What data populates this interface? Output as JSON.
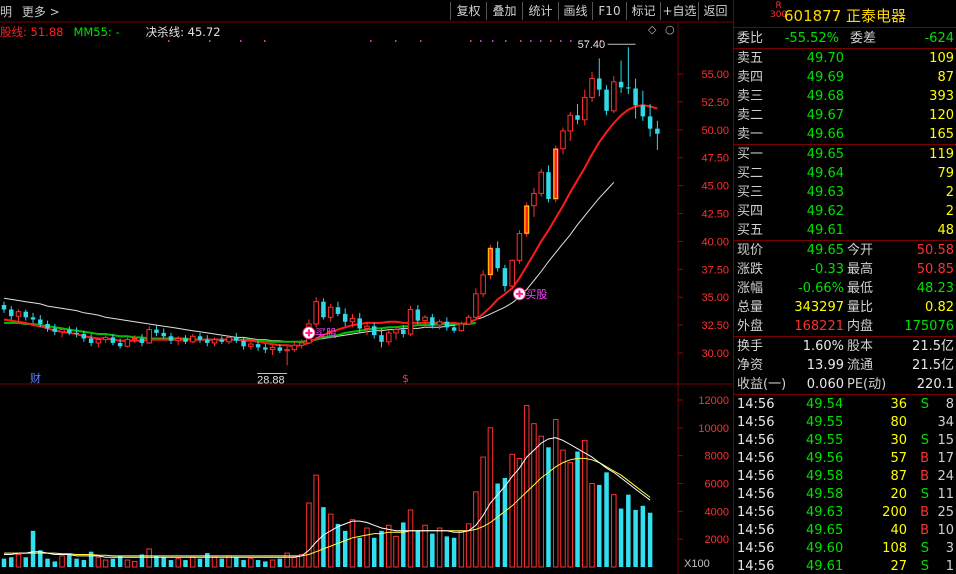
{
  "toolbar": {
    "left_text": "明",
    "more": "更多 >",
    "buttons": [
      "复权",
      "叠加",
      "统计",
      "画线",
      "F10",
      "标记",
      "+自选",
      "返回"
    ]
  },
  "indicator": {
    "line_a": "股线: 51.88",
    "line_b": "MM55: -",
    "line_c": "决杀线: 45.72",
    "diamond": "◇",
    "circle": "○"
  },
  "chart_data": [
    {
      "type": "candlestick",
      "yaxis": {
        "ticks": [
          "55.00",
          "52.50",
          "50.00",
          "47.50",
          "45.00",
          "42.50",
          "40.00",
          "37.50",
          "35.00",
          "32.50",
          "30.00"
        ]
      },
      "annotations": {
        "high": "57.40",
        "low": "28.88",
        "buy_label": "买股",
        "fin_label": "财",
        "dollar": "$"
      },
      "candles": [
        [
          34.3,
          34.6,
          33.6,
          33.9
        ],
        [
          33.9,
          34.2,
          33.0,
          33.3
        ],
        [
          33.3,
          33.9,
          32.8,
          33.7
        ],
        [
          33.7,
          33.9,
          32.9,
          33.2
        ],
        [
          33.2,
          33.6,
          32.7,
          33.0
        ],
        [
          33.0,
          33.4,
          32.3,
          32.6
        ],
        [
          32.6,
          32.9,
          31.9,
          32.2
        ],
        [
          32.2,
          32.6,
          31.6,
          31.9
        ],
        [
          31.9,
          32.3,
          31.4,
          32.1
        ],
        [
          32.1,
          32.4,
          31.6,
          31.8
        ],
        [
          31.8,
          32.3,
          31.4,
          31.7
        ],
        [
          31.7,
          32.0,
          31.0,
          31.3
        ],
        [
          31.3,
          31.7,
          30.6,
          30.9
        ],
        [
          30.9,
          31.4,
          30.5,
          31.2
        ],
        [
          31.2,
          31.6,
          30.9,
          31.4
        ],
        [
          31.4,
          31.7,
          30.7,
          30.9
        ],
        [
          30.9,
          31.3,
          30.4,
          30.6
        ],
        [
          30.6,
          31.4,
          30.5,
          31.2
        ],
        [
          31.2,
          31.6,
          30.9,
          31.3
        ],
        [
          31.3,
          31.7,
          30.6,
          30.9
        ],
        [
          30.9,
          32.4,
          30.8,
          32.1
        ],
        [
          32.1,
          32.5,
          31.5,
          31.8
        ],
        [
          31.8,
          32.2,
          31.3,
          31.5
        ],
        [
          31.5,
          31.8,
          30.8,
          31.1
        ],
        [
          31.1,
          31.5,
          30.7,
          31.3
        ],
        [
          31.3,
          31.6,
          30.8,
          31.0
        ],
        [
          31.0,
          31.7,
          30.9,
          31.5
        ],
        [
          31.5,
          31.8,
          30.9,
          31.2
        ],
        [
          31.2,
          31.6,
          30.6,
          30.9
        ],
        [
          30.9,
          31.4,
          30.6,
          31.2
        ],
        [
          31.2,
          31.5,
          30.8,
          31.0
        ],
        [
          31.0,
          31.6,
          30.8,
          31.4
        ],
        [
          31.4,
          31.8,
          30.9,
          31.1
        ],
        [
          31.1,
          31.4,
          30.3,
          30.6
        ],
        [
          30.6,
          31.0,
          30.3,
          30.8
        ],
        [
          30.8,
          31.1,
          30.2,
          30.5
        ],
        [
          30.5,
          30.8,
          30.0,
          30.3
        ],
        [
          30.3,
          30.7,
          29.8,
          30.5
        ],
        [
          30.5,
          30.8,
          30.0,
          30.2
        ],
        [
          30.2,
          30.6,
          28.9,
          30.3
        ],
        [
          30.3,
          31.0,
          30.1,
          30.7
        ],
        [
          30.7,
          31.2,
          30.4,
          30.9
        ],
        [
          30.9,
          33.0,
          30.8,
          32.6
        ],
        [
          32.6,
          35.0,
          32.3,
          34.6
        ],
        [
          34.6,
          34.9,
          33.0,
          33.2
        ],
        [
          33.2,
          34.4,
          32.8,
          34.1
        ],
        [
          34.1,
          34.6,
          33.3,
          33.5
        ],
        [
          33.5,
          34.0,
          32.4,
          32.8
        ],
        [
          32.8,
          33.5,
          32.3,
          33.1
        ],
        [
          33.1,
          33.6,
          31.8,
          32.2
        ],
        [
          32.2,
          32.8,
          31.6,
          32.4
        ],
        [
          32.4,
          32.7,
          31.3,
          31.6
        ],
        [
          31.6,
          32.2,
          30.5,
          31.0
        ],
        [
          31.0,
          32.0,
          30.7,
          31.8
        ],
        [
          31.8,
          32.4,
          31.2,
          32.1
        ],
        [
          32.1,
          32.5,
          31.4,
          31.7
        ],
        [
          31.7,
          34.2,
          31.5,
          33.9
        ],
        [
          33.9,
          34.3,
          32.6,
          32.9
        ],
        [
          32.9,
          33.4,
          32.3,
          33.2
        ],
        [
          33.2,
          33.5,
          32.2,
          32.5
        ],
        [
          32.5,
          33.0,
          32.1,
          32.8
        ],
        [
          32.8,
          33.2,
          32.0,
          32.3
        ],
        [
          32.3,
          32.6,
          31.8,
          32.0
        ],
        [
          32.0,
          32.8,
          31.9,
          32.6
        ],
        [
          32.6,
          33.4,
          32.5,
          33.2
        ],
        [
          33.2,
          35.8,
          33.1,
          35.3
        ],
        [
          35.3,
          37.4,
          35.0,
          37.0
        ],
        [
          37.0,
          39.7,
          36.6,
          39.4
        ],
        [
          39.4,
          40.0,
          37.3,
          37.6
        ],
        [
          37.6,
          37.9,
          35.5,
          36.0
        ],
        [
          36.0,
          38.4,
          35.8,
          38.3
        ],
        [
          38.3,
          41.0,
          38.0,
          40.7
        ],
        [
          40.7,
          43.5,
          40.4,
          43.2
        ],
        [
          43.2,
          44.8,
          42.2,
          44.3
        ],
        [
          44.3,
          46.5,
          44.0,
          46.2
        ],
        [
          46.2,
          46.8,
          43.5,
          43.8
        ],
        [
          43.8,
          48.6,
          43.5,
          48.3
        ],
        [
          48.3,
          50.2,
          47.8,
          49.9
        ],
        [
          49.9,
          51.6,
          49.0,
          51.3
        ],
        [
          51.3,
          52.3,
          50.5,
          50.9
        ],
        [
          50.9,
          53.6,
          50.4,
          52.9
        ],
        [
          52.9,
          55.2,
          52.5,
          54.6
        ],
        [
          54.6,
          56.4,
          53.0,
          53.6
        ],
        [
          53.6,
          54.0,
          51.3,
          51.7
        ],
        [
          51.7,
          54.8,
          51.5,
          54.3
        ],
        [
          54.3,
          56.2,
          53.3,
          53.8
        ],
        [
          53.8,
          57.4,
          53.2,
          53.7
        ],
        [
          53.7,
          54.6,
          51.0,
          52.2
        ],
        [
          52.2,
          53.5,
          50.8,
          51.2
        ],
        [
          51.2,
          52.3,
          49.4,
          50.1
        ],
        [
          50.1,
          50.8,
          48.2,
          49.65
        ]
      ],
      "ma_red": [
        33.0,
        32.9,
        32.8,
        32.7,
        32.5,
        32.4,
        32.2,
        32.0,
        31.9,
        31.8,
        31.7,
        31.5,
        31.4,
        31.3,
        31.3,
        31.2,
        31.1,
        31.1,
        31.1,
        31.1,
        31.2,
        31.2,
        31.2,
        31.2,
        31.2,
        31.2,
        31.2,
        31.2,
        31.2,
        31.2,
        31.2,
        31.2,
        31.2,
        31.1,
        31.1,
        31.0,
        30.9,
        30.8,
        30.7,
        30.7,
        30.6,
        30.7,
        30.9,
        31.3,
        31.6,
        31.9,
        32.1,
        32.3,
        32.5,
        32.6,
        32.7,
        32.7,
        32.7,
        32.8,
        32.8,
        32.7,
        32.7,
        32.7,
        32.7,
        32.7,
        32.7,
        32.7,
        32.7,
        32.6,
        32.7,
        33.0,
        33.5,
        34.1,
        34.8,
        35.3,
        35.8,
        36.7,
        37.8,
        38.9,
        40.0,
        41.0,
        42.1,
        43.2,
        44.4,
        45.5,
        46.6,
        47.8,
        48.9,
        49.8,
        50.6,
        51.3,
        51.8,
        52.1,
        52.2,
        52.1,
        51.9
      ],
      "ma_green": [
        32.7,
        32.7,
        32.7,
        32.6,
        32.6,
        32.5,
        32.4,
        32.3,
        32.2,
        32.1,
        32.0,
        31.9,
        31.8,
        31.7,
        31.7,
        31.6,
        31.5,
        31.5,
        31.4,
        31.4,
        31.3,
        31.3,
        31.3,
        31.3,
        31.3,
        31.3,
        31.2,
        31.2,
        31.2,
        31.2,
        31.2,
        31.2,
        31.2,
        31.2,
        31.2,
        31.1,
        31.1,
        31.0,
        31.0,
        31.0,
        31.0,
        31.0,
        31.1,
        31.2,
        31.4,
        31.5,
        31.6,
        31.8,
        31.9,
        32.0,
        32.1,
        32.2,
        32.2,
        32.3,
        32.3,
        32.4,
        32.4,
        32.5,
        32.5,
        32.5,
        32.6,
        32.6,
        32.6,
        32.6,
        32.6,
        32.7
      ],
      "ma_white": [
        34.9,
        34.8,
        34.7,
        34.6,
        34.5,
        34.4,
        34.2,
        34.1,
        34.0,
        33.9,
        33.8,
        33.6,
        33.5,
        33.4,
        33.2,
        33.1,
        33.0,
        32.9,
        32.8,
        32.7,
        32.6,
        32.5,
        32.4,
        32.3,
        32.2,
        32.1,
        32.0,
        31.9,
        31.8,
        31.7,
        31.6,
        31.5,
        31.4,
        31.4,
        31.3,
        31.2,
        31.2,
        31.1,
        31.1,
        31.0,
        31.0,
        31.0,
        31.1,
        31.2,
        31.3,
        31.4,
        31.5,
        31.6,
        31.7,
        31.8,
        31.9,
        32.0,
        32.0,
        32.1,
        32.1,
        32.2,
        32.2,
        32.2,
        32.3,
        32.3,
        32.3,
        32.4,
        32.5,
        32.6,
        32.8,
        33.0,
        33.2,
        33.5,
        33.8,
        34.1,
        34.5,
        35.0,
        35.7,
        36.5,
        37.3,
        38.2,
        39.0,
        39.8,
        40.6,
        41.5,
        42.3,
        43.1,
        43.9,
        44.6,
        45.3
      ]
    },
    {
      "type": "bar",
      "yaxis": {
        "ticks": [
          "12000",
          "10000",
          "8000",
          "6000",
          "4000",
          "2000"
        ],
        "unit": "X100"
      },
      "volumes": [
        600,
        700,
        900,
        700,
        2600,
        1200,
        600,
        400,
        800,
        900,
        600,
        500,
        1100,
        700,
        500,
        600,
        800,
        500,
        400,
        900,
        1300,
        800,
        700,
        500,
        600,
        500,
        700,
        600,
        1000,
        700,
        600,
        800,
        700,
        500,
        600,
        500,
        400,
        500,
        600,
        1000,
        700,
        900,
        4600,
        6600,
        4300,
        3800,
        3100,
        2600,
        3400,
        2100,
        2800,
        2100,
        2600,
        3000,
        2200,
        3200,
        4100,
        2600,
        3000,
        2400,
        2800,
        2200,
        2100,
        2600,
        3100,
        5400,
        7900,
        10000,
        6000,
        6400,
        8100,
        7800,
        11600,
        10300,
        9400,
        8600,
        10600,
        8400,
        7500,
        8300,
        9100,
        6000,
        5900,
        6800,
        5200,
        4200,
        5200,
        4100,
        4400,
        3900
      ],
      "ma_vol": [
        900,
        900,
        1000,
        1000,
        1100,
        1100,
        1000,
        900,
        900,
        900,
        800,
        800,
        800,
        800,
        700,
        700,
        700,
        700,
        700,
        700,
        700,
        700,
        700,
        700,
        700,
        700,
        700,
        700,
        700,
        700,
        700,
        700,
        700,
        700,
        700,
        700,
        700,
        700,
        700,
        700,
        700,
        800,
        1200,
        1800,
        2300,
        2600,
        2900,
        3100,
        3300,
        3300,
        3200,
        3000,
        2800,
        2700,
        2600,
        2600,
        2600,
        2600,
        2600,
        2600,
        2600,
        2600,
        2500,
        2500,
        2600,
        3000,
        3700,
        4600,
        5200,
        5800,
        6500,
        7100,
        7900,
        8400,
        8900,
        9200,
        9300,
        9100,
        8800,
        8500,
        8200,
        7900,
        7500,
        7100,
        6800,
        6400,
        6000,
        5600,
        5200,
        4800
      ],
      "ma_vol2": [
        1000,
        1000,
        1000,
        1000,
        1000,
        1000,
        1000,
        1000,
        950,
        950,
        900,
        900,
        900,
        850,
        850,
        800,
        800,
        800,
        800,
        800,
        800,
        800,
        800,
        800,
        800,
        800,
        800,
        800,
        800,
        800,
        800,
        800,
        800,
        800,
        800,
        800,
        800,
        800,
        800,
        800,
        800,
        800,
        900,
        1100,
        1300,
        1500,
        1700,
        1900,
        2100,
        2200,
        2300,
        2400,
        2400,
        2500,
        2500,
        2500,
        2600,
        2600,
        2600,
        2600,
        2600,
        2600,
        2600,
        2600,
        2600,
        2700,
        2900,
        3200,
        3600,
        4000,
        4400,
        4900,
        5400,
        5900,
        6400,
        6800,
        7200,
        7500,
        7700,
        7800,
        7800,
        7700,
        7500,
        7200,
        6900,
        6600,
        6200,
        5800,
        5400,
        5000
      ]
    }
  ],
  "quote": {
    "badge_r": "R",
    "badge_300": "300",
    "code": "601877 正泰电器",
    "weibi_label": "委比",
    "weibi": "-55.52%",
    "weicha_label": "委差",
    "weicha": "-624",
    "asks": [
      {
        "label": "卖五",
        "price": "49.70",
        "vol": "109"
      },
      {
        "label": "卖四",
        "price": "49.69",
        "vol": "87"
      },
      {
        "label": "卖三",
        "price": "49.68",
        "vol": "393"
      },
      {
        "label": "卖二",
        "price": "49.67",
        "vol": "120"
      },
      {
        "label": "卖一",
        "price": "49.66",
        "vol": "165"
      }
    ],
    "bids": [
      {
        "label": "买一",
        "price": "49.65",
        "vol": "119"
      },
      {
        "label": "买二",
        "price": "49.64",
        "vol": "79"
      },
      {
        "label": "买三",
        "price": "49.63",
        "vol": "2"
      },
      {
        "label": "买四",
        "price": "49.62",
        "vol": "2"
      },
      {
        "label": "买五",
        "price": "49.61",
        "vol": "48"
      }
    ],
    "stats": [
      {
        "l1": "现价",
        "v1": "49.65",
        "c1": "green",
        "l2": "今开",
        "v2": "50.58",
        "c2": "red"
      },
      {
        "l1": "涨跌",
        "v1": "-0.33",
        "c1": "green",
        "l2": "最高",
        "v2": "50.85",
        "c2": "red"
      },
      {
        "l1": "涨幅",
        "v1": "-0.66%",
        "c1": "green",
        "l2": "最低",
        "v2": "48.23",
        "c2": "green"
      },
      {
        "l1": "总量",
        "v1": "343297",
        "c1": "yellow",
        "l2": "量比",
        "v2": "0.82",
        "c2": "yellow"
      },
      {
        "l1": "外盘",
        "v1": "168221",
        "c1": "red",
        "l2": "内盘",
        "v2": "175076",
        "c2": "green"
      }
    ],
    "stats2": [
      {
        "l1": "换手",
        "v1": "1.60%",
        "l2": "股本",
        "v2": "21.5亿"
      },
      {
        "l1": "净资",
        "v1": "13.99",
        "l2": "流通",
        "v2": "21.5亿"
      },
      {
        "l1": "收益(一)",
        "v1": "0.060",
        "l2": "PE(动)",
        "v2": "220.1"
      }
    ],
    "ticks": [
      {
        "t": "14:56",
        "p": "49.54",
        "v": "36",
        "s": "S",
        "n": "8"
      },
      {
        "t": "14:56",
        "p": "49.55",
        "v": "80",
        "s": "",
        "n": "34"
      },
      {
        "t": "14:56",
        "p": "49.55",
        "v": "30",
        "s": "S",
        "n": "15"
      },
      {
        "t": "14:56",
        "p": "49.56",
        "v": "57",
        "s": "B",
        "n": "17"
      },
      {
        "t": "14:56",
        "p": "49.58",
        "v": "87",
        "s": "B",
        "n": "24"
      },
      {
        "t": "14:56",
        "p": "49.58",
        "v": "20",
        "s": "S",
        "n": "11"
      },
      {
        "t": "14:56",
        "p": "49.63",
        "v": "200",
        "s": "B",
        "n": "25"
      },
      {
        "t": "14:56",
        "p": "49.65",
        "v": "40",
        "s": "B",
        "n": "10"
      },
      {
        "t": "14:56",
        "p": "49.60",
        "v": "108",
        "s": "S",
        "n": "3"
      },
      {
        "t": "14:56",
        "p": "49.61",
        "v": "27",
        "s": "S",
        "n": "1"
      }
    ]
  }
}
